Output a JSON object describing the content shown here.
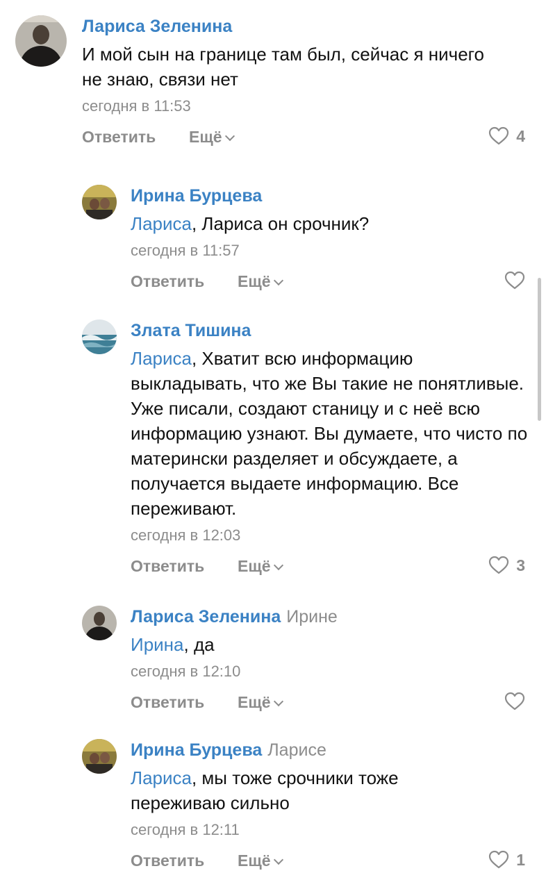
{
  "labels": {
    "reply": "Ответить",
    "more": "Ещё"
  },
  "colors": {
    "link": "#3b82c4",
    "meta": "#8c8c8c"
  },
  "comments": [
    {
      "author": "Лариса Зеленина",
      "reply_to": "",
      "mention": "",
      "text": "И мой сын на границе там был, сейчас я ничего не знаю, связи нет",
      "date": "сегодня в 11:53",
      "likes": "4"
    },
    {
      "author": "Ирина Бурцева",
      "reply_to": "",
      "mention": "Лариса",
      "text": ", Лариса он срочник?",
      "date": "сегодня в 11:57",
      "likes": ""
    },
    {
      "author": "Злата Тишина",
      "reply_to": "",
      "mention": "Лариса",
      "text": ", Хватит всю информацию выкладывать, что же Вы такие не понятливые. Уже писали, создают станицу и с неё всю информацию узнают. Вы думаете, что чисто по матерински разделяет и обсуждаете, а получается выдаете информацию. Все переживают.",
      "date": "сегодня в 12:03",
      "likes": "3"
    },
    {
      "author": "Лариса Зеленина",
      "reply_to": "Ирине",
      "mention": "Ирина",
      "text": ", да",
      "date": "сегодня в 12:10",
      "likes": ""
    },
    {
      "author": "Ирина Бурцева",
      "reply_to": "Ларисе",
      "mention": "Лариса",
      "text": ", мы тоже срочники тоже переживаю сильно",
      "date": "сегодня в 12:11",
      "likes": "1"
    }
  ]
}
